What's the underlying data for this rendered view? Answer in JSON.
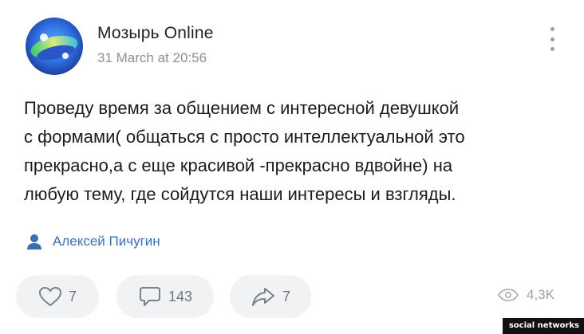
{
  "header": {
    "group_name": "Мозырь Online",
    "date": "31 March at 20:56"
  },
  "post": {
    "lines": [
      "Проведу время за общением с интересной девушкой",
      "с формами( общаться с просто интеллектуальной это",
      "прекрасно,а с еще красивой -прекрасно вдвойне) на",
      "любую тему, где сойдутся наши интересы и взгляды."
    ]
  },
  "author": {
    "name": "Алексей Пичугин"
  },
  "actions": {
    "likes": "7",
    "comments": "143",
    "shares": "7",
    "views": "4,3K"
  },
  "watermark": "social networks",
  "colors": {
    "author_link": "#3a6fb5",
    "pill_bg": "#f1f2f4",
    "muted": "#8a8f99"
  }
}
